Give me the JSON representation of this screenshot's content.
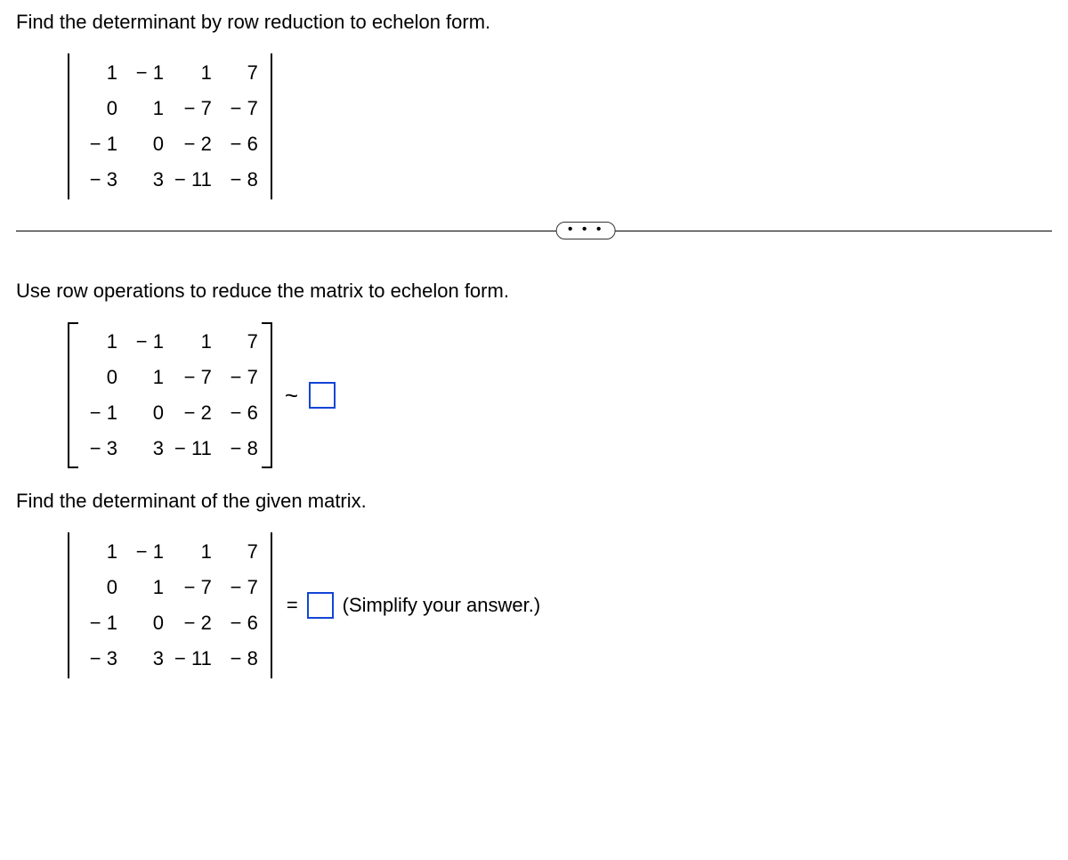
{
  "prompt": "Find the determinant by row reduction to echelon form.",
  "matrix": {
    "r0": {
      "c0": "1",
      "c1": "− 1",
      "c2": "1",
      "c3": "7"
    },
    "r1": {
      "c0": "0",
      "c1": "1",
      "c2": "− 7",
      "c3": "− 7"
    },
    "r2": {
      "c0": "− 1",
      "c1": "0",
      "c2": "− 2",
      "c3": "− 6"
    },
    "r3": {
      "c0": "− 3",
      "c1": "3",
      "c2": "− 11",
      "c3": "− 8"
    }
  },
  "section1": "Use row operations to reduce the matrix to echelon form.",
  "tilde_symbol": "~",
  "section2": "Find the determinant of the given matrix.",
  "equals": "=",
  "hint": "(Simplify your answer.)",
  "ellipsis": "• • •"
}
